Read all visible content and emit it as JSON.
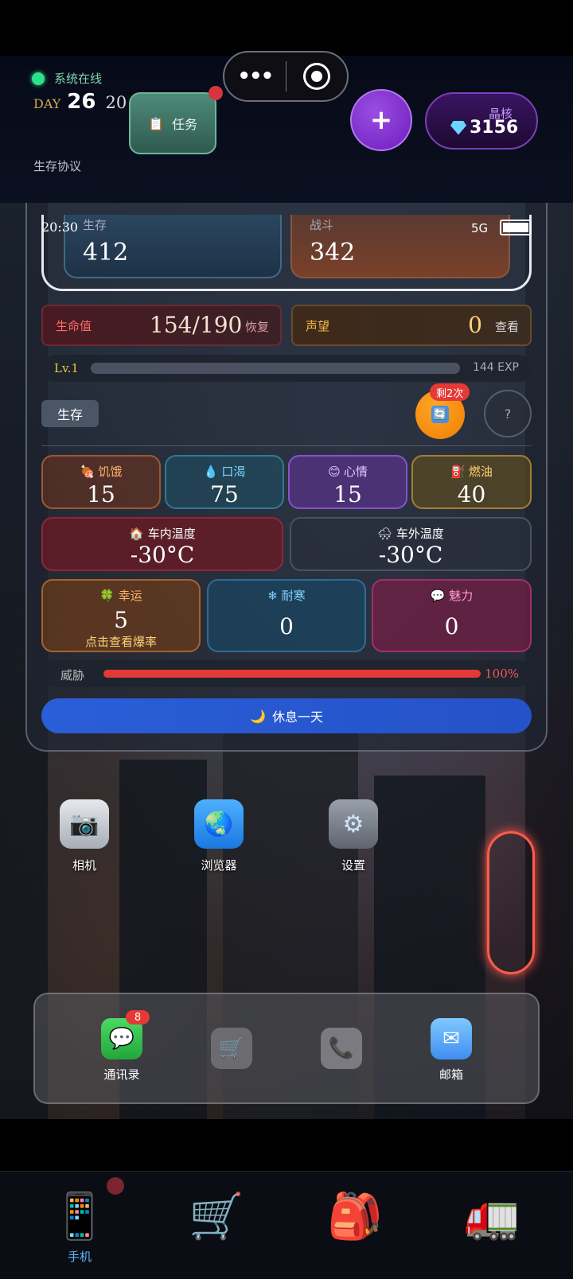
{
  "header": {
    "online_text": "系统在线",
    "day_label": "DAY",
    "day_number": "26",
    "hour": "20",
    "protocol_link": "生存协议",
    "task_button": "任务",
    "plus_button": "+",
    "crystal_label": "晶核",
    "crystal_value": "3156"
  },
  "phone_status": {
    "time": "20:30",
    "network": "5G"
  },
  "stat_cards": [
    {
      "label": "生存",
      "value": "412"
    },
    {
      "label": "战斗",
      "value": "342"
    }
  ],
  "hp": {
    "label": "生命值",
    "value": "154/190",
    "action": "恢复"
  },
  "reputation": {
    "label": "声望",
    "value": "0",
    "action": "查看"
  },
  "level": {
    "label": "Lv.1",
    "exp": "144 EXP",
    "progress": 0
  },
  "mode_tag": "生存",
  "refresh": {
    "remaining": "剩2次"
  },
  "help_label": "?",
  "attributes": [
    {
      "label": "饥饿",
      "value": "15"
    },
    {
      "label": "口渴",
      "value": "75"
    },
    {
      "label": "心情",
      "value": "15"
    },
    {
      "label": "燃油",
      "value": "40"
    }
  ],
  "temperatures": [
    {
      "label": "车内温度",
      "value": "-30°C"
    },
    {
      "label": "车外温度",
      "value": "-30°C"
    }
  ],
  "big_attributes": [
    {
      "label": "幸运",
      "value": "5",
      "sub": "点击查看爆率"
    },
    {
      "label": "耐寒",
      "value": "0"
    },
    {
      "label": "魅力",
      "value": "0"
    }
  ],
  "threat": {
    "label": "威胁",
    "percent": "100%",
    "level": 1.0
  },
  "rest_button": "休息一天",
  "home_apps": [
    {
      "name": "相机"
    },
    {
      "name": "浏览器"
    },
    {
      "name": "设置"
    }
  ],
  "dock": {
    "contacts": {
      "name": "通讯录",
      "badge": "8"
    },
    "mail": {
      "name": "邮箱"
    }
  },
  "nav": {
    "phone_label": "手机"
  }
}
